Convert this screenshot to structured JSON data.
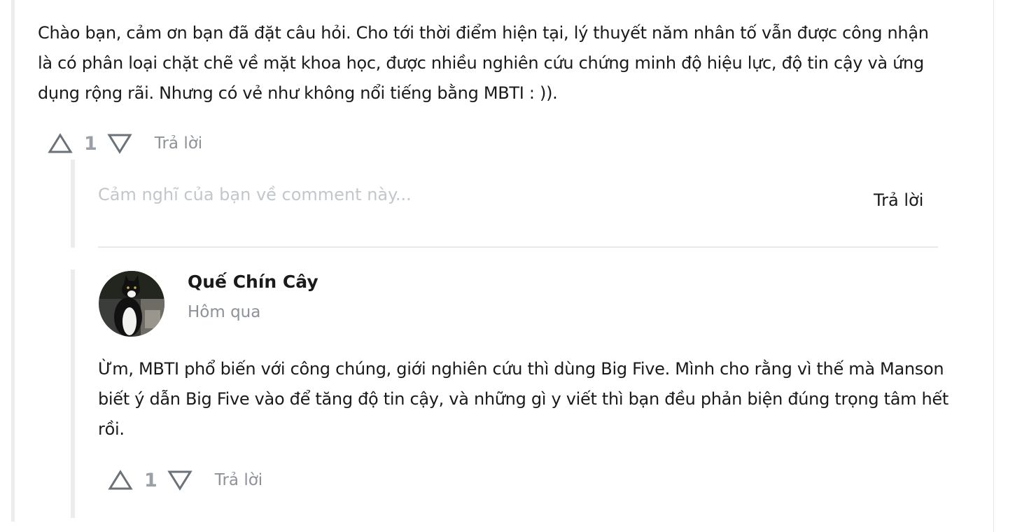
{
  "comment": {
    "text": "Chào bạn, cảm ơn bạn đã đặt câu hỏi. Cho tới thời điểm hiện tại, lý thuyết năm nhân tố vẫn được công nhận là có phân loại chặt chẽ về mặt khoa học, được nhiều nghiên cứu chứng minh độ hiệu lực, độ tin cậy và ứng dụng rộng rãi. Nhưng có vẻ như không nổi tiếng bằng MBTI : )).",
    "vote_count": "1",
    "reply_label": "Trả lời"
  },
  "reply_box": {
    "placeholder": "Cảm nghĩ của bạn về comment này...",
    "submit_label": "Trả lời"
  },
  "reply": {
    "author": "Quế Chín Cây",
    "time": "Hôm qua",
    "text": "Ừm, MBTI phổ biến với công chúng, giới nghiên cứu thì dùng Big Five. Mình cho rằng vì thế mà Manson biết ý dẫn Big Five vào để tăng độ tin cậy, và những gì y viết thì bạn đều phản biện đúng trọng tâm hết rồi.",
    "vote_count": "1",
    "reply_label": "Trả lời"
  },
  "icons": {
    "upvote": "triangle-up-outline-icon",
    "downvote": "triangle-down-outline-icon",
    "avatar": "cat-photo-avatar"
  },
  "colors": {
    "text": "#1a1a1a",
    "muted": "#8c9298",
    "vote_icon": "#6b7278",
    "placeholder": "#c2c7cc",
    "thread_line": "#ececec"
  }
}
